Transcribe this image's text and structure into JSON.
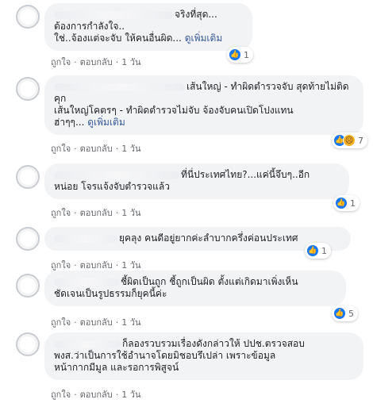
{
  "comments": [
    {
      "lines": [
        "จริงที่สุด...",
        "ต้องการกำลังใจ..",
        "ใช่..จ้องแต่จะจับ ให้คนอื่นผิด... "
      ],
      "see_more": "ดูเพิ่มเติม",
      "reaction_count": "1",
      "like_label": "ถูกใจ",
      "reply_label": "ตอบกลับ",
      "time": "1 วัน"
    },
    {
      "lines": [
        "เส้นใหญ่ - ทำผิดตำรวจจับ สุดท้ายไม่ติด",
        "คุก",
        "เส้นใหญ่โคตรๆ - ทำผิดตำรวจไม่จับ จ้องจับคนเปิดโปงแทน",
        "ฮ่าๆๆ... "
      ],
      "see_more": "ดูเพิ่มเติม",
      "reaction_count": "7",
      "like_label": "ถูกใจ",
      "reply_label": "ตอบกลับ",
      "time": "1 วัน"
    },
    {
      "lines": [
        "ที่นี่ประเทศไทย?...แค่นี้จึบๆ..อีก",
        "หน่อย โจรแจ้งจับตำรวจแล้ว"
      ],
      "reaction_count": "1",
      "like_label": "ถูกใจ",
      "reply_label": "ตอบกลับ",
      "time": "1 วัน"
    },
    {
      "lines": [
        "ยุคลุง คนดีอยู่ยากค่ะลำบากครึ่งค่อนประเทศ"
      ],
      "reaction_count": "1",
      "like_label": "ถูกใจ",
      "reply_label": "ตอบกลับ",
      "time": "1 วัน"
    },
    {
      "lines": [
        "ชี้ผิดเป็นถูก ชี้ถูกเป็นผิด ตั้งแต่เกิดมาเพิ่งเห็น",
        "ชัดเจนเป็นรูปธรรมก็ยุคนี้ค่ะ"
      ],
      "reaction_count": "5",
      "like_label": "ถูกใจ",
      "reply_label": "ตอบกลับ",
      "time": "1 วัน"
    },
    {
      "lines": [
        "ก็ลองรวบรวมเรื่องดังกล่าวให้ ปปช.ตรวจสอบ",
        "พงส.ว่าเป็นการใช้อำนาจโดยมิชอบรึเปล่า เพราะข้อมูล",
        "หน้ากากมีมูล และรอการพิสูจน์"
      ],
      "like_label": "ถูกใจ",
      "reply_label": "ตอบกลับ",
      "time": "1 วัน"
    }
  ],
  "icons": {
    "like": "thumbs-up-icon",
    "sad": "sad-face-icon"
  },
  "colors": {
    "bubble": "#f2f3f5",
    "link": "#385898",
    "like": "#1877f2",
    "meta_text": "#65676b"
  }
}
